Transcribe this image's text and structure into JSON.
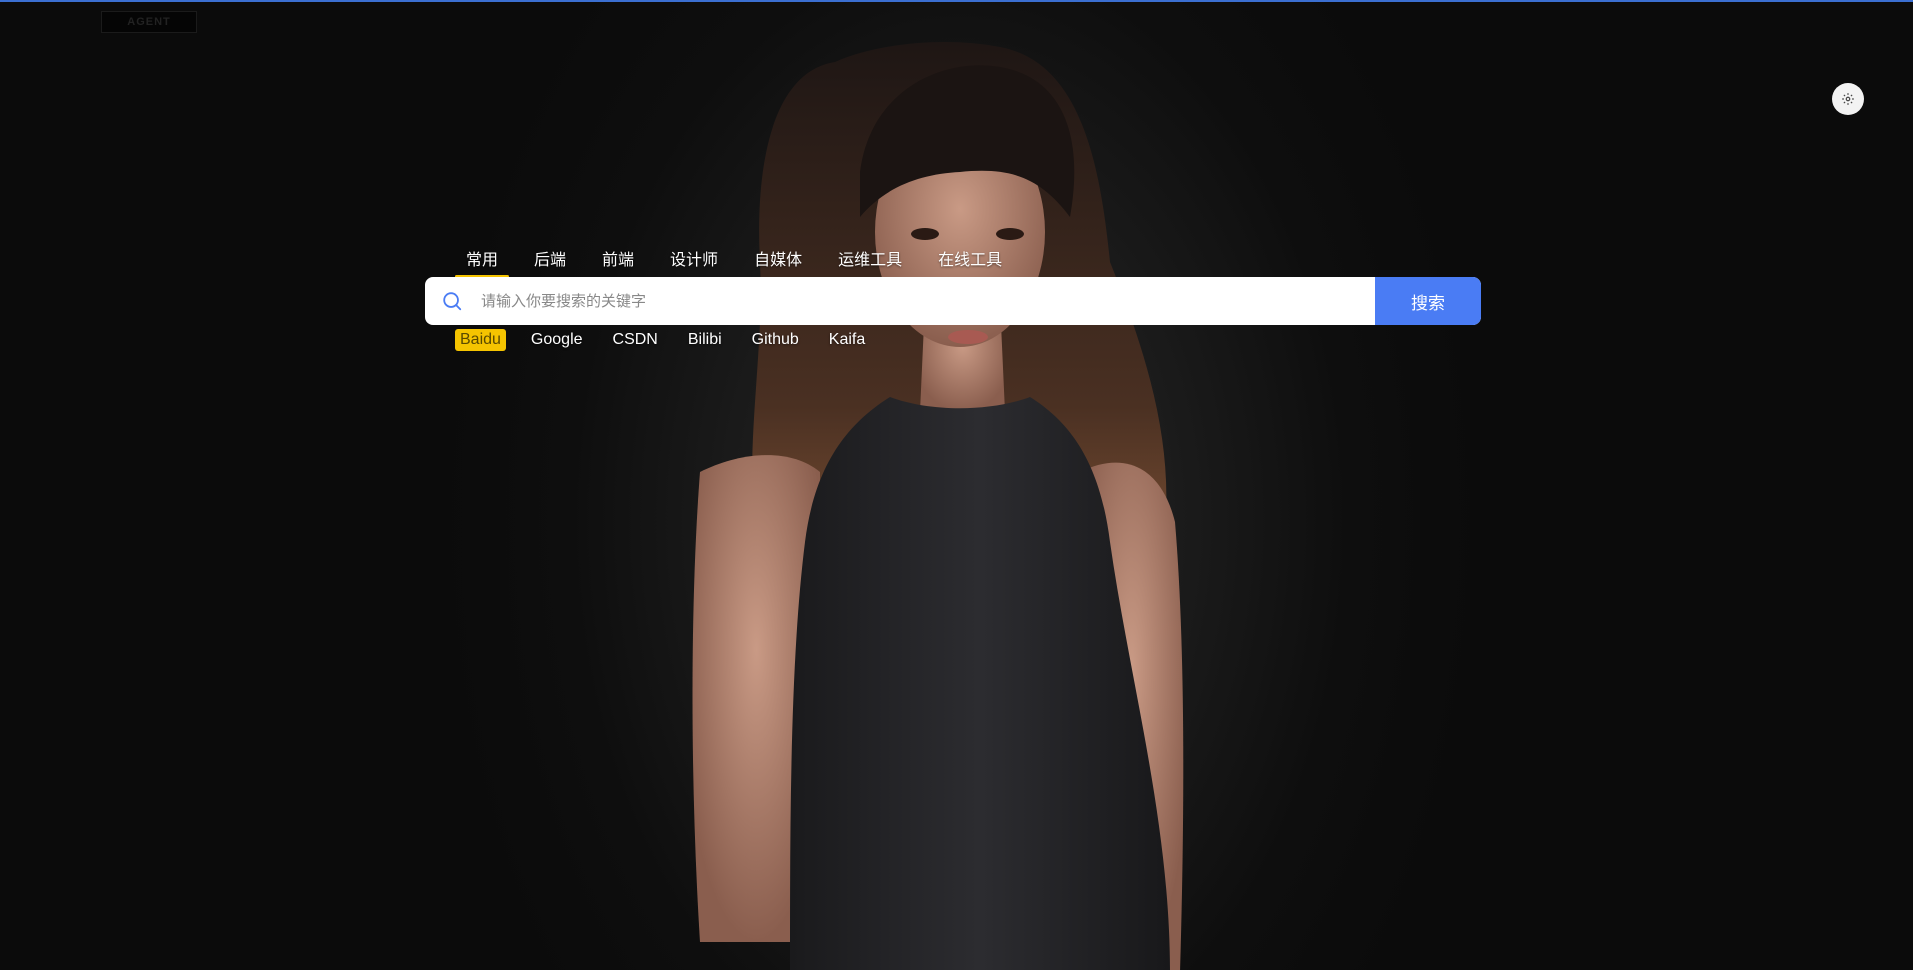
{
  "logo": {
    "text": "AGENT"
  },
  "settings": {
    "icon": "gear-icon",
    "background": "#f3f3f3"
  },
  "tabs": [
    {
      "label": "常用",
      "active": true
    },
    {
      "label": "后端",
      "active": false
    },
    {
      "label": "前端",
      "active": false
    },
    {
      "label": "设计师",
      "active": false
    },
    {
      "label": "自媒体",
      "active": false
    },
    {
      "label": "运维工具",
      "active": false
    },
    {
      "label": "在线工具",
      "active": false
    }
  ],
  "search": {
    "icon": "search-icon",
    "placeholder": "请输入你要搜索的关键字",
    "value": "",
    "button_label": "搜索",
    "button_color": "#4a7cf4"
  },
  "engines": [
    {
      "label": "Baidu",
      "active": true
    },
    {
      "label": "Google",
      "active": false
    },
    {
      "label": "CSDN",
      "active": false
    },
    {
      "label": "Bilibi",
      "active": false
    },
    {
      "label": "Github",
      "active": false
    },
    {
      "label": "Kaifa",
      "active": false
    }
  ],
  "colors": {
    "accent": "#f5c400",
    "primary": "#4a7cf4",
    "background": "#0c0c0c"
  }
}
